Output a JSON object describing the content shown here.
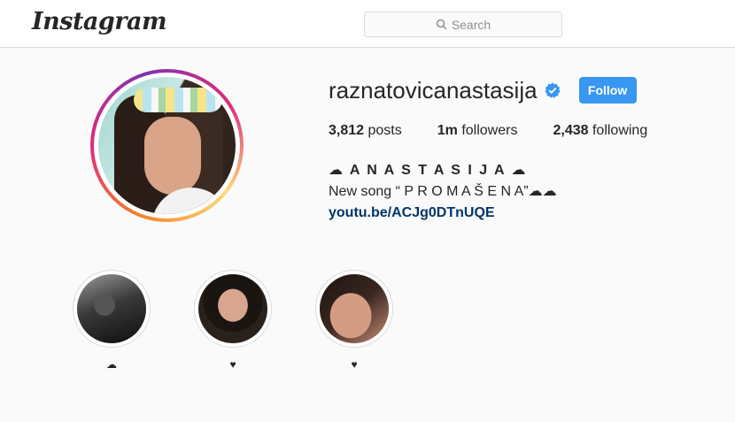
{
  "header": {
    "logo_text": "Instagram",
    "search_placeholder": "Search"
  },
  "profile": {
    "username": "raznatovicanastasija",
    "verified": true,
    "follow_label": "Follow",
    "accent_color": "#3897f0",
    "stats": {
      "posts_count": "3,812",
      "posts_label": "posts",
      "followers_count": "1m",
      "followers_label": "followers",
      "following_count": "2,438",
      "following_label": "following"
    },
    "bio": {
      "name": "☁ A N A S T A S I J A ☁",
      "line1": "New song “ P R O M A Š E N A”☁☁",
      "link": "youtu.be/ACJg0DTnUQE"
    }
  },
  "highlights": [
    {
      "label": "☁"
    },
    {
      "label": "♥"
    },
    {
      "label": "♥"
    }
  ]
}
